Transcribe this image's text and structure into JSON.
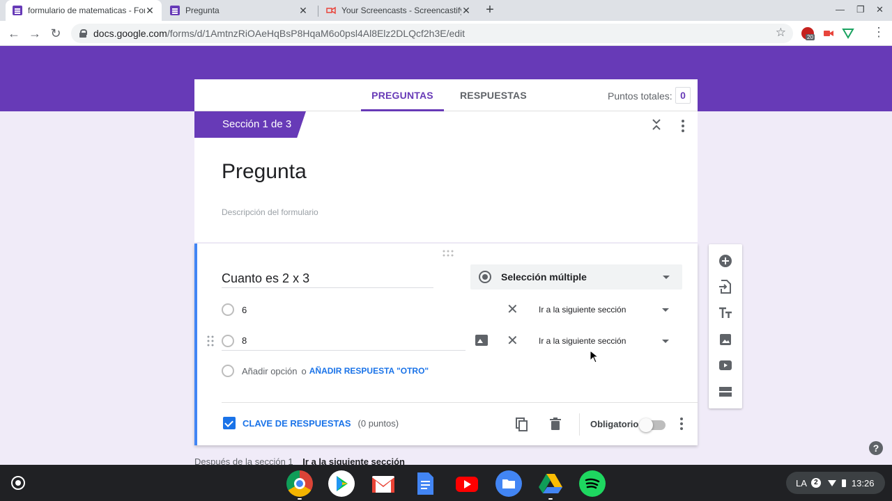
{
  "browser": {
    "tabs": [
      {
        "title": "formulario de matematicas - Formularios de Google",
        "active": true
      },
      {
        "title": "Pregunta",
        "active": false
      },
      {
        "title": "Your Screencasts - Screencastify",
        "active": false
      }
    ],
    "url_host": "docs.google.com",
    "url_path": "/forms/d/1AmtnzRiOAeHqBsP8HqaM6o0psl4Al8Elz2DLQcf2h3E/edit",
    "extension_badge": "20"
  },
  "form": {
    "tabs": {
      "questions": "PREGUNTAS",
      "responses": "RESPUESTAS"
    },
    "points_label": "Puntos totales:",
    "points_value": "0",
    "section_label": "Sección 1 de 3",
    "title": "Pregunta",
    "description_placeholder": "Descripción del formulario",
    "question": {
      "title": "Cuanto es 2 x 3",
      "type": "Selección múltiple",
      "options": [
        {
          "label": "6",
          "goto": "Ir a la siguiente sección"
        },
        {
          "label": "8",
          "goto": "Ir a la siguiente sección"
        }
      ],
      "add_option": "Añadir opción",
      "or": "o",
      "add_other": "AÑADIR RESPUESTA \"OTRO\"",
      "answer_key": "CLAVE DE RESPUESTAS",
      "answer_points": "(0 puntos)",
      "required": "Obligatorio"
    },
    "after_section_label": "Después de la sección 1",
    "after_section_value": "Ir a la siguiente sección"
  },
  "shelf": {
    "tray_lang": "LA",
    "tray_badge": "2",
    "time": "13:26"
  },
  "colors": {
    "primary": "#673ab7",
    "accent": "#4285f4",
    "link": "#1a73e8"
  }
}
